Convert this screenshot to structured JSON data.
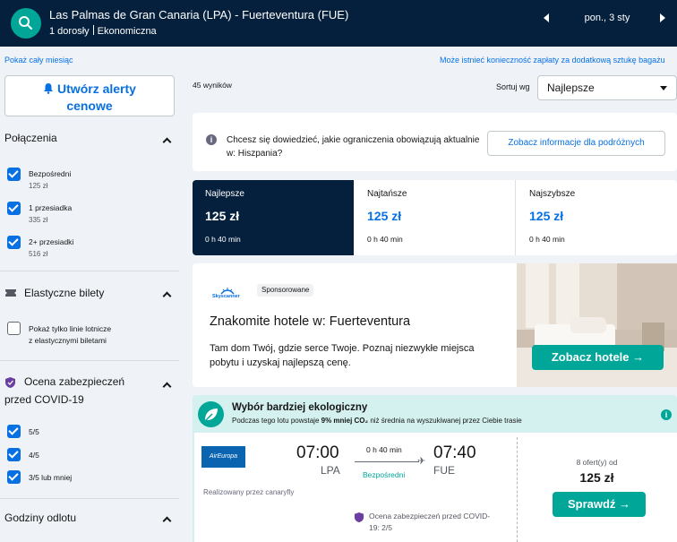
{
  "header": {
    "route": "Las Palmas de Gran Canaria (LPA) - Fuerteventura (FUE)",
    "passengers": "1 dorosły",
    "cabin": "Ekonomiczna",
    "date": "pon., 3 sty"
  },
  "links": {
    "show_month": "Pokaż cały miesiąc",
    "bag_note": "Może istnieć konieczność zapłaty za dodatkową sztukę bagażu"
  },
  "sidebar": {
    "alert_line1": "Utwórz alerty",
    "alert_line2": "cenowe",
    "connections": {
      "title": "Połączenia",
      "options": [
        {
          "label": "Bezpośredni",
          "price": "125 zł"
        },
        {
          "label": "1 przesiadka",
          "price": "335 zł"
        },
        {
          "label": "2+ przesiadki",
          "price": "516 zł"
        }
      ]
    },
    "flexible": {
      "title": "Elastyczne bilety",
      "option_line1": "Pokaż tylko linie lotnicze",
      "option_line2": "z elastycznymi biletami"
    },
    "covid": {
      "title_line1": "Ocena zabezpieczeń",
      "title_line2": "przed COVID-19",
      "options": [
        "5/5",
        "4/5",
        "3/5 lub mniej"
      ]
    },
    "departure": {
      "title": "Godziny odlotu"
    }
  },
  "results": {
    "count": "45 wyników",
    "sort_label": "Sortuj wg",
    "sort_value": "Najlepsze"
  },
  "info": {
    "text": "Chcesz się dowiedzieć, jakie ograniczenia obowiązują aktualnie w: Hiszpania?",
    "button": "Zobacz informacje dla podróżnych"
  },
  "sort_tabs": [
    {
      "label": "Najlepsze",
      "price": "125 zł",
      "duration": "0 h 40 min"
    },
    {
      "label": "Najtańsze",
      "price": "125 zł",
      "duration": "0 h 40 min"
    },
    {
      "label": "Najszybsze",
      "price": "125 zł",
      "duration": "0 h 40 min"
    }
  ],
  "hotel_ad": {
    "logo": "Skyscanner",
    "sponsored": "Sponsorowane",
    "title": "Znakomite hotele w: Fuerteventura",
    "desc": "Tam dom Twój, gdzie serce Twoje. Poznaj niezwykłe miejsca pobytu i uzyskaj najlepszą cenę.",
    "button": "Zobacz hotele →"
  },
  "eco": {
    "title": "Wybór bardziej ekologiczny",
    "sub_before": "Podczas tego lotu powstaje ",
    "sub_bold": "9% mniej CO₂",
    "sub_after": " niż średnia na wyszukiwanej przez Ciebie trasie"
  },
  "flight": {
    "airline_logo": "AirEuropa",
    "dep_time": "07:00",
    "dep_code": "LPA",
    "arr_time": "07:40",
    "arr_code": "FUE",
    "duration": "0 h 40 min",
    "stops": "Bezpośredni",
    "operated_by": "Realizowany przez canaryfly",
    "covid_line1": "Ocena zabezpieczeń przed COVID-",
    "covid_line2": "19: 2/5",
    "offers": "8 ofert(y) od",
    "price": "125 zł",
    "button": "Sprawdź →"
  },
  "colors": {
    "header_bg": "#05203c",
    "accent_teal": "#00a698",
    "link_blue": "#0770e3",
    "eco_bg": "#d4f1f0"
  },
  "icons": [
    "search-icon",
    "bell-icon",
    "ticket-icon",
    "shield-icon",
    "leaf-icon",
    "info-icon",
    "plane-icon",
    "chevron-up-icon",
    "chevron-left-icon",
    "chevron-right-icon"
  ]
}
